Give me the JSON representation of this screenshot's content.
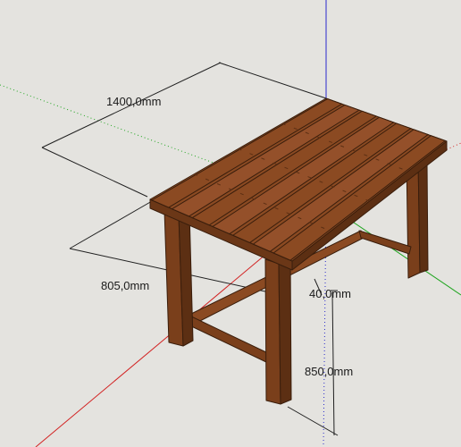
{
  "viewport": {
    "background": "#e4e3df",
    "axes": {
      "red_axis_color": "#d22222",
      "green_axis_color": "#1fa51f",
      "blue_axis_color": "#2a2acc"
    }
  },
  "model": {
    "wood_top_color": "#8b4a22",
    "wood_side_color": "#6b3717",
    "wood_edge_color": "#3a1e0c"
  },
  "dimensions": {
    "length_label": "1400,0mm",
    "width_label": "805,0mm",
    "slat_label": "40,0mm",
    "height_label": "850,0mm"
  }
}
